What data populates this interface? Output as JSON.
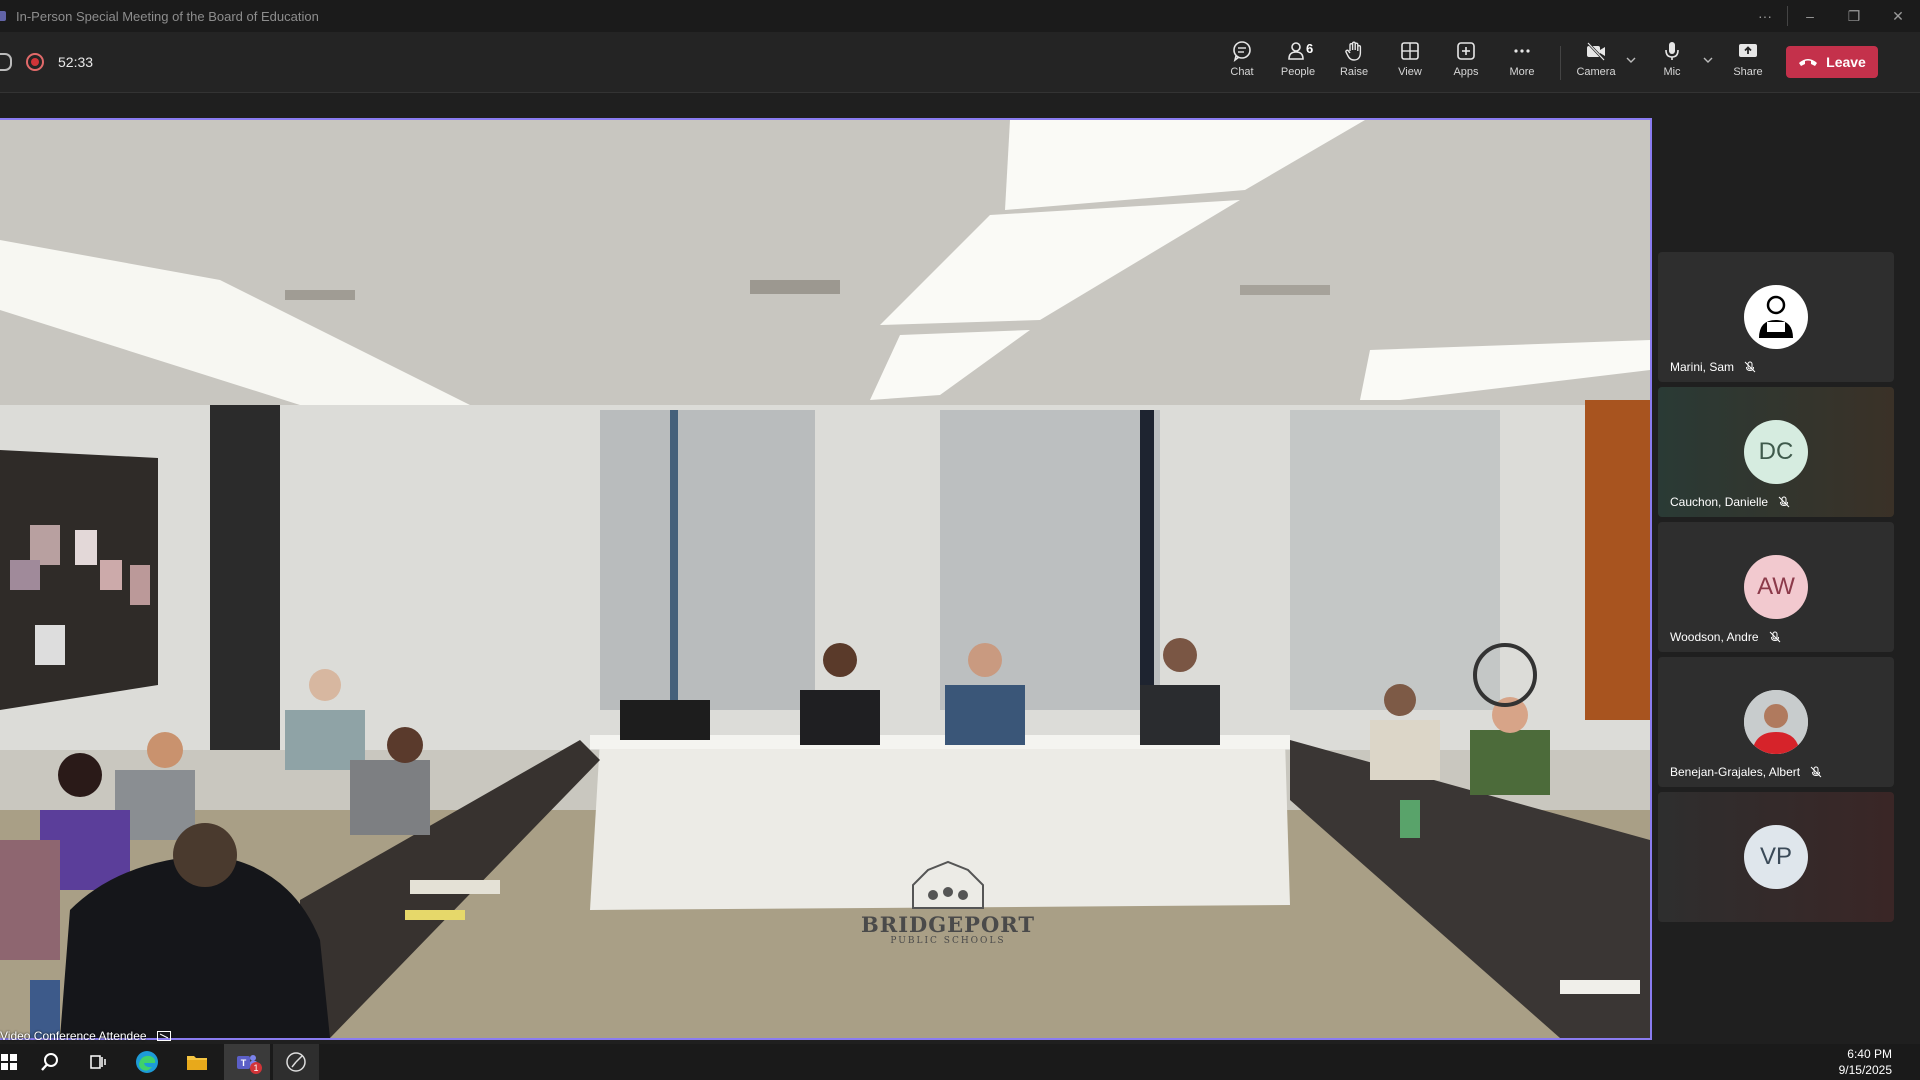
{
  "window": {
    "title": "In-Person Special Meeting of the Board of Education"
  },
  "meeting": {
    "elapsed": "52:33",
    "recording": true
  },
  "toolbar": {
    "chat_label": "Chat",
    "people_label": "People",
    "people_count": "6",
    "raise_label": "Raise",
    "view_label": "View",
    "apps_label": "Apps",
    "more_label": "More",
    "camera_label": "Camera",
    "mic_label": "Mic",
    "share_label": "Share",
    "leave_label": "Leave"
  },
  "stage": {
    "caption": "Video Conference Attendee",
    "table_banner_line1": "BRIDGEPORT",
    "table_banner_line2": "PUBLIC SCHOOLS"
  },
  "participants": [
    {
      "name": "Marini, Sam",
      "initials": "",
      "avatar": "person-icon",
      "muted": true
    },
    {
      "name": "Cauchon, Danielle",
      "initials": "DC",
      "avatar_color": "#d6ece0",
      "muted": true
    },
    {
      "name": "Woodson, Andre",
      "initials": "AW",
      "avatar_color": "#f2c9cf",
      "muted": true
    },
    {
      "name": "Benejan-Grajales, Albert",
      "initials": "",
      "avatar": "photo",
      "muted": true
    },
    {
      "name": "",
      "initials": "VP",
      "avatar_color": "#dfe6ec",
      "muted": false
    }
  ],
  "taskbar": {
    "time": "6:40 PM",
    "date": "9/15/2025",
    "teams_badge": "1"
  },
  "colors": {
    "leave_red": "#c4314b",
    "stage_border": "#8a7cf0",
    "record_red": "#d13438"
  }
}
